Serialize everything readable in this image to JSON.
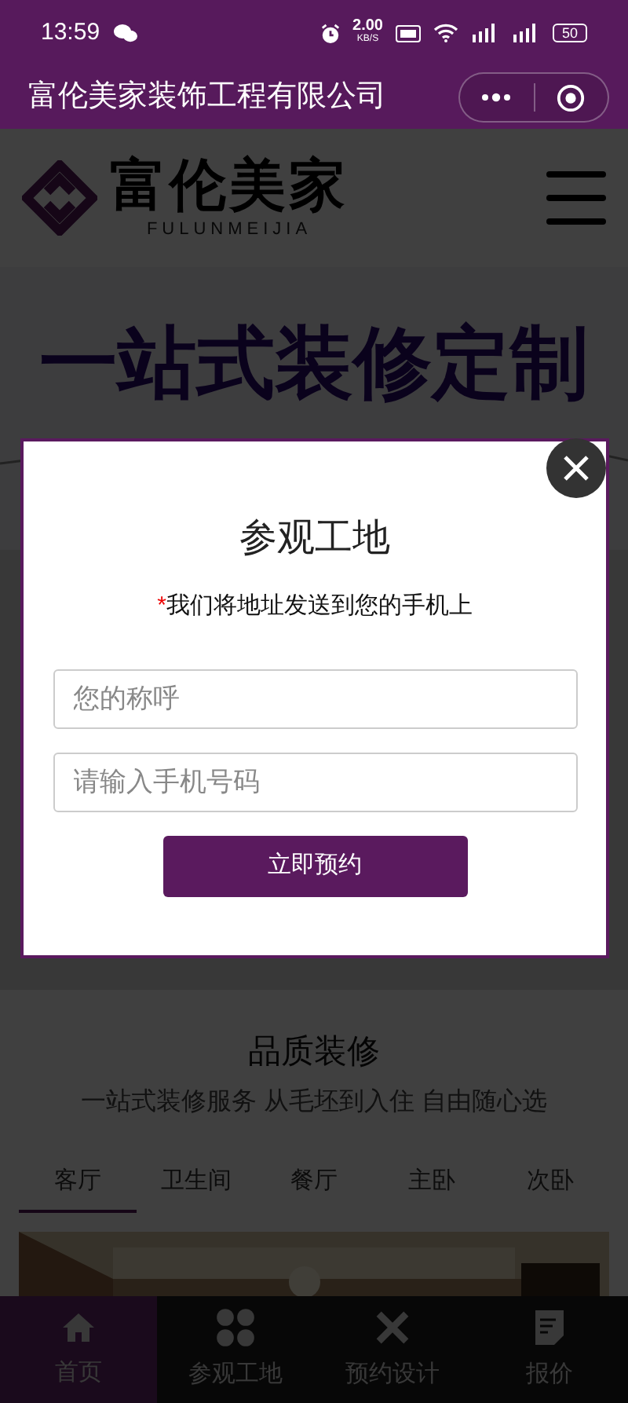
{
  "status_bar": {
    "time": "13:59",
    "speed": "2.00",
    "speed_unit": "KB/S",
    "battery": "50"
  },
  "header": {
    "title": "富伦美家装饰工程有限公司"
  },
  "logo": {
    "name": "富伦美家",
    "pinyin": "FULUNMEIJIA"
  },
  "banner": {
    "headline": "一站式装修定制"
  },
  "section": {
    "title": "品质装修",
    "subtitle": "一站式装修服务 从毛坯到入住 自由随心选"
  },
  "room_tabs": [
    {
      "label": "客厅",
      "selected": true
    },
    {
      "label": "卫生间",
      "selected": false
    },
    {
      "label": "餐厅",
      "selected": false
    },
    {
      "label": "主卧",
      "selected": false
    },
    {
      "label": "次卧",
      "selected": false
    }
  ],
  "bottom_nav": [
    {
      "label": "首页",
      "kind": "home",
      "selected": true
    },
    {
      "label": "参观工地",
      "kind": "grid",
      "selected": false
    },
    {
      "label": "预约设计",
      "kind": "tools",
      "selected": false
    },
    {
      "label": "报价",
      "kind": "quote",
      "selected": false
    }
  ],
  "modal": {
    "title": "参观工地",
    "required_mark": "*",
    "note": "我们将地址发送到您的手机上",
    "name_field": {
      "placeholder": "您的称呼"
    },
    "phone_field": {
      "placeholder": "请输入手机号码"
    },
    "submit": "立即预约"
  }
}
